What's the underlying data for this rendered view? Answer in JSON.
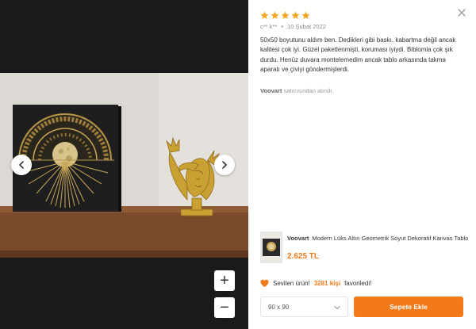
{
  "review": {
    "rating": 5,
    "max_rating": 5,
    "star_color": "#f5a623",
    "author": "c** k**",
    "separator": "•",
    "date": "10 Şubat 2022",
    "text": "50x50 boyutunu aldım ben. Dedikleri gibi baskı, kabartma değil ancak kalitesi çok iyi. Güzel paketlenmişti, koruması iyiydi. Biblomla çok şık durdu. Henüz duvara montelemedim ancak tablo arkasında takma aparatı ve çiviyi göndermişlerdi.",
    "seller_name": "Voovart",
    "seller_suffix": " satıcısından alındı."
  },
  "viewer": {
    "prev_icon": "chevron-left-icon",
    "next_icon": "chevron-right-icon",
    "zoom_in_label": "+",
    "zoom_out_label": "−"
  },
  "product": {
    "brand": "Voovart",
    "title": "Modern Lüks Altın Geometrik Soyut Dekoratif Kanvas Tablo",
    "price": "2.625 TL"
  },
  "favorite": {
    "prefix": "Sevilen ürün!",
    "count": "3281 kişi",
    "suffix": "favoriledi!"
  },
  "size_select": {
    "value": "90 x 90"
  },
  "cart": {
    "label": "Sepete Ekle"
  },
  "colors": {
    "accent": "#f27a1a",
    "viewer_bg": "#1a1a1a"
  }
}
